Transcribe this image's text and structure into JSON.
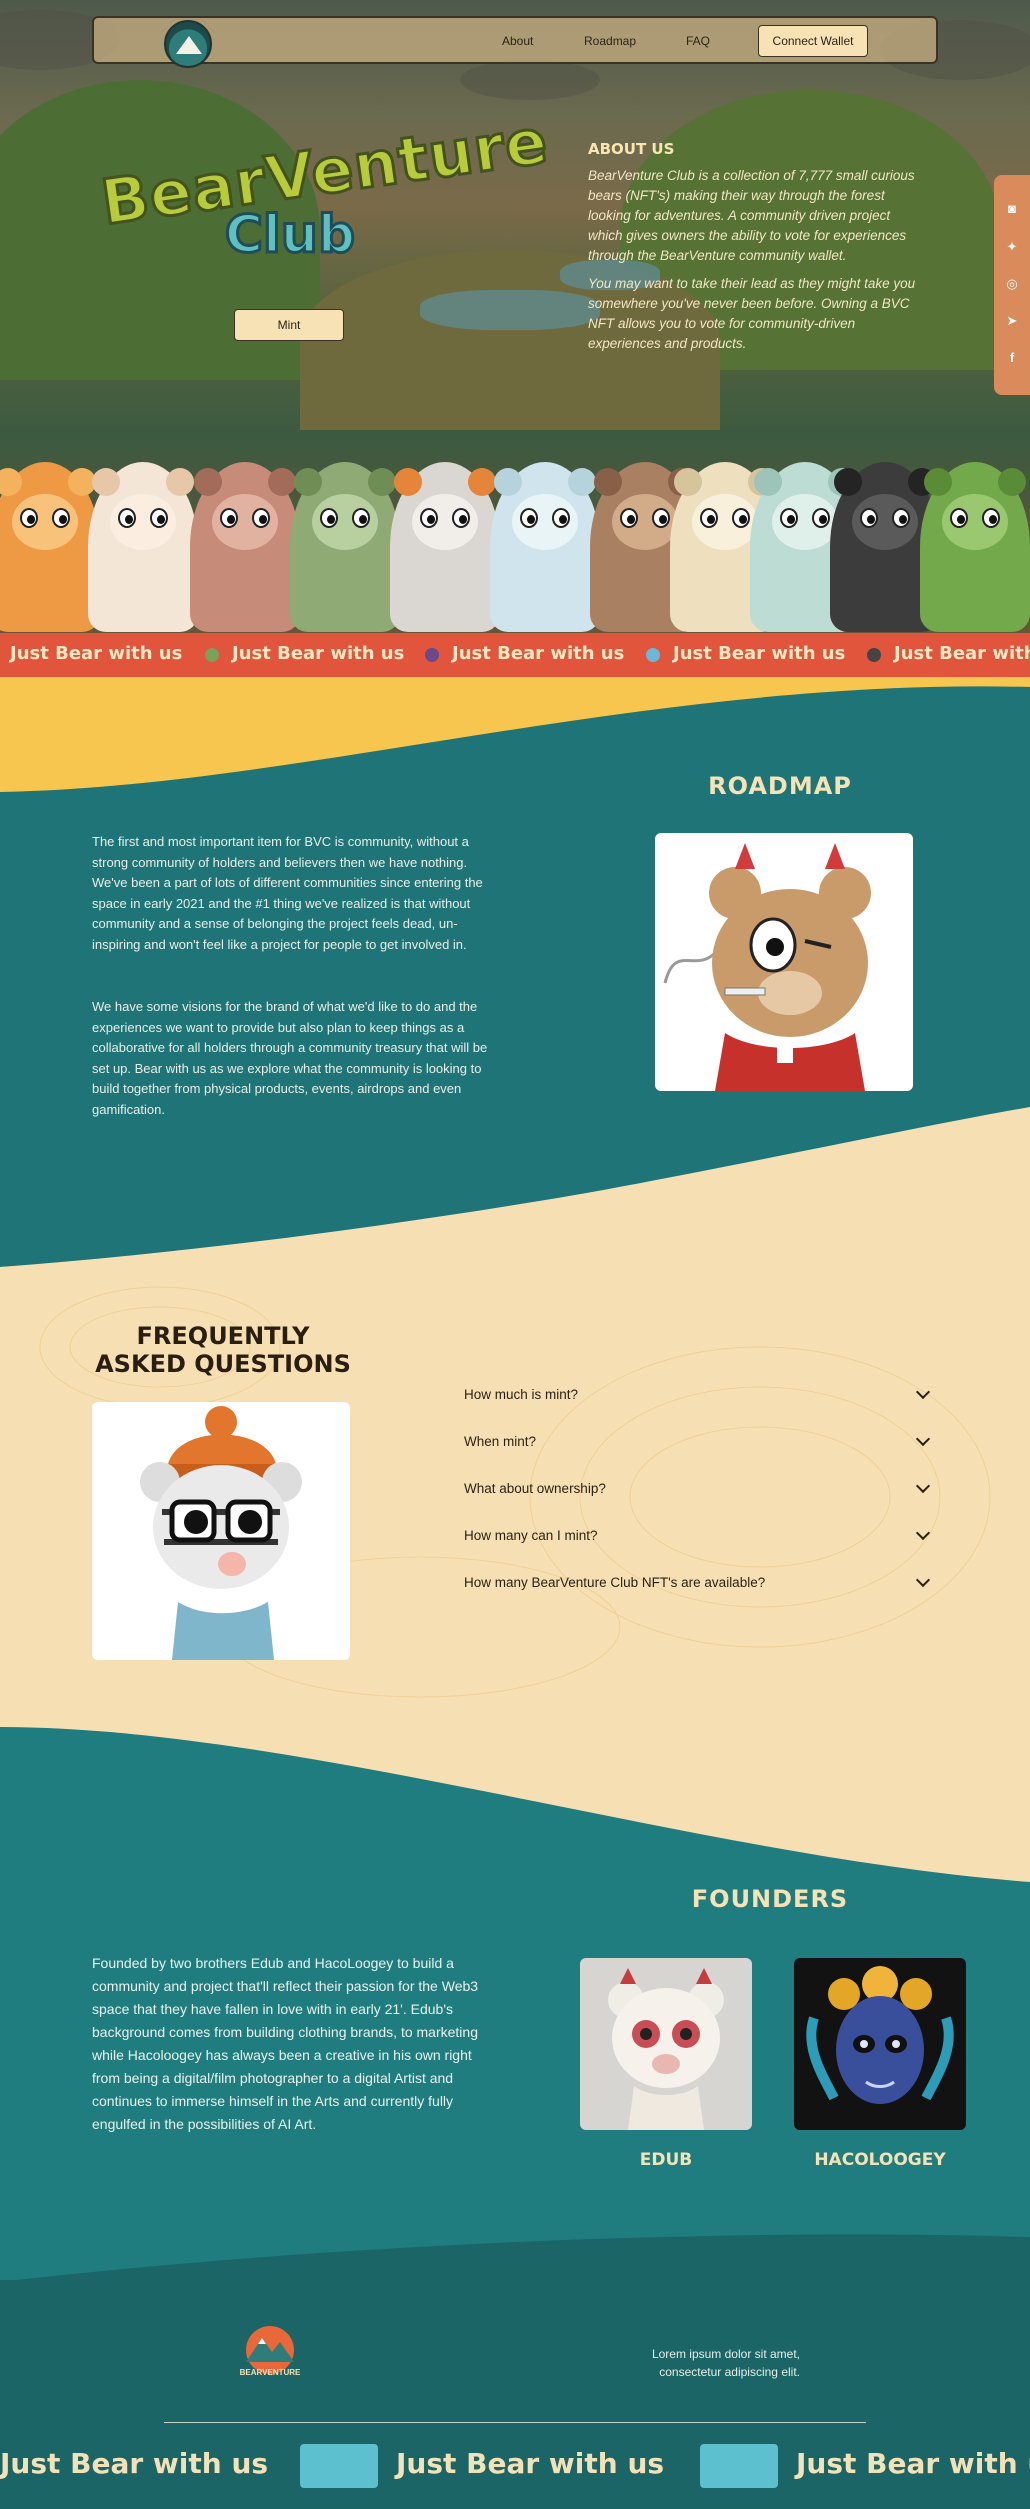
{
  "nav": {
    "links": [
      "About",
      "Roadmap",
      "FAQ"
    ],
    "connect_label": "Connect Wallet",
    "logo_text": "BEARVENTURE"
  },
  "hero": {
    "title_line1": "BearVenture",
    "title_line2": "Club",
    "mint_label": "Mint"
  },
  "about": {
    "heading": "ABOUT US",
    "p1": "BearVenture Club is a collection of 7,777 small curious bears (NFT's) making their way through the forest looking for adventures. A community driven project which gives owners the ability to vote for experiences through the BearVenture community wallet.",
    "p2": "You may want to take their lead as they might take you somewhere you've never been before. Owning a BVC NFT allows you to vote for community-driven experiences and products."
  },
  "social": {
    "icons": [
      "discord-icon",
      "twitter-icon",
      "instagram-icon",
      "telegram-icon",
      "facebook-icon"
    ]
  },
  "marquee": {
    "phrase": "Just Bear with us"
  },
  "roadmap": {
    "heading": "ROADMAP",
    "p1": "The first and most important item for BVC is community, without a strong community of holders and believers then we have nothing. We've been a part of lots of different communities since entering the space in early 2021 and the #1 thing we've realized is that without community and a sense of belonging the project feels dead, un-inspiring and won't feel like a project for people to get involved in.",
    "p2": "We have some visions for the brand of what we'd like to do and the experiences we want to provide but also plan to keep things as a collaborative for all holders through a community treasury that will be set up. Bear with us as we explore what the community is looking to build together from physical products, events, airdrops and even gamification."
  },
  "faq": {
    "heading_line1": "FREQUENTLY",
    "heading_line2": "ASKED QUESTIONS",
    "questions": [
      "How much is mint?",
      "When mint?",
      "What about ownership?",
      "How many can I mint?",
      "How many BearVenture Club NFT's are available?"
    ]
  },
  "founders": {
    "heading": "FOUNDERS",
    "text": "Founded by two brothers Edub and HacoLoogey to build a community and project that'll reflect their passion for the Web3 space that they have fallen in love with in early 21'. Edub's background comes from building clothing brands, to marketing while Hacoloogey has always been a creative in his own right from being a digital/film photographer to a digital Artist and continues to immerse himself in the Arts and currently fully engulfed in the possibilities of AI Art.",
    "names": [
      "EDUB",
      "HACOLOOGEY"
    ]
  },
  "footer": {
    "logo_text": "BEARVENTURE",
    "text_line1": "Lorem ipsum dolor sit amet,",
    "text_line2": "consectetur adipiscing elit."
  },
  "colors": {
    "teal": "#1f7478",
    "cream": "#f6e0b3",
    "red": "#e0553b",
    "yellow": "#f7c64e"
  }
}
